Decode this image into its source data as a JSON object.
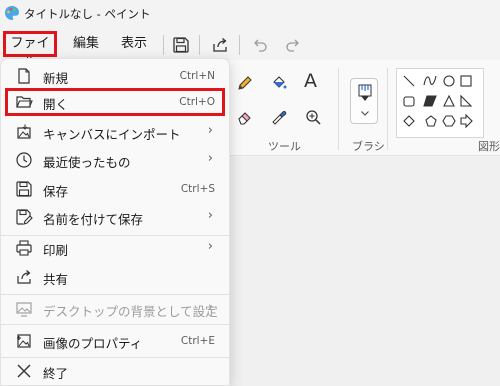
{
  "window": {
    "title": "タイトルなし - ペイント"
  },
  "menubar": {
    "file_label": "ファイル",
    "edit_label": "編集",
    "view_label": "表示",
    "quick_tools": [
      "save-icon",
      "share-icon",
      "undo-icon",
      "redo-icon"
    ]
  },
  "ribbon": {
    "tools_label": "ツール",
    "brush_label": "ブラシ",
    "shapes_label": "図形",
    "text_tool_glyph": "A"
  },
  "file_menu": {
    "items": [
      {
        "label": "新規",
        "shortcut": "Ctrl+N",
        "icon": "new-file-icon"
      },
      {
        "label": "開く",
        "shortcut": "Ctrl+O",
        "icon": "folder-open-icon"
      },
      {
        "label": "キャンバスにインポート",
        "submenu": true,
        "icon": "import-image-icon"
      },
      {
        "label": "最近使ったもの",
        "submenu": true,
        "icon": "clock-icon"
      },
      {
        "label": "保存",
        "shortcut": "Ctrl+S",
        "icon": "save-icon"
      },
      {
        "label": "名前を付けて保存",
        "submenu": true,
        "icon": "save-as-icon"
      },
      {
        "label": "印刷",
        "submenu": true,
        "icon": "printer-icon"
      },
      {
        "label": "共有",
        "icon": "share-icon"
      },
      {
        "label": "デスクトップの背景として設定",
        "submenu": true,
        "disabled": true,
        "icon": "desktop-background-icon"
      },
      {
        "label": "画像のプロパティ",
        "shortcut": "Ctrl+E",
        "icon": "image-properties-icon"
      },
      {
        "label": "終了",
        "icon": "close-icon"
      }
    ],
    "submenu_arrow": "›"
  },
  "colors": {
    "highlight": "#e0151c",
    "menu_bg": "#f9f9f9",
    "window_bg": "#f3f3f3"
  }
}
